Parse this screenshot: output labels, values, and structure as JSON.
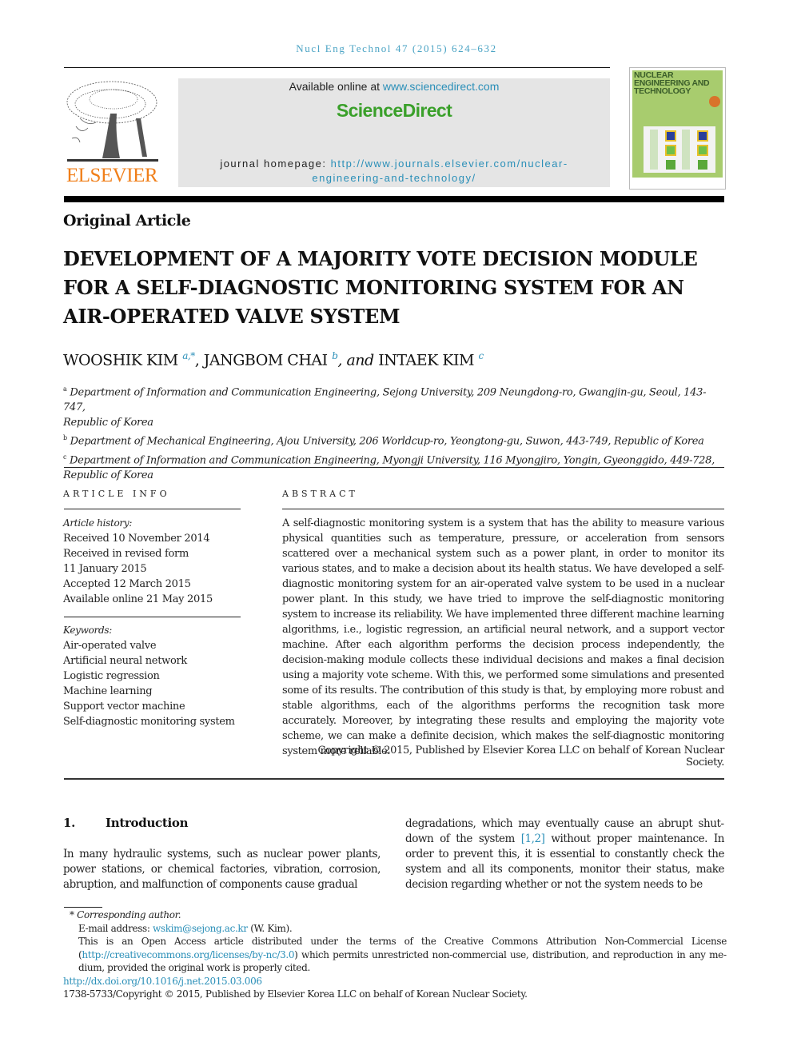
{
  "header": {
    "citation": "Nucl Eng Technol 47 (2015) 624–632",
    "publisher_logo_text": "ELSEVIER",
    "available_prefix": "Available online at ",
    "available_link": "www.sciencedirect.com",
    "sciencedirect_logo": "ScienceDirect",
    "homepage_prefix": "journal homepage: ",
    "homepage_link_line1": "http://www.journals.elsevier.com/nuclear-",
    "homepage_link_line2": "engineering-and-technology/",
    "cover_title_lines": [
      "NUCLEAR",
      "ENGINEERING AND",
      "TECHNOLOGY"
    ]
  },
  "article": {
    "type": "Original Article",
    "title_lines": [
      "DEVELOPMENT OF A MAJORITY VOTE DECISION MODULE",
      "FOR A SELF-DIAGNOSTIC MONITORING SYSTEM FOR AN",
      "AIR-OPERATED VALVE SYSTEM"
    ],
    "authors": [
      {
        "name": "WOOSHIK KIM",
        "sup": "a,*"
      },
      {
        "name": "JANGBOM CHAI",
        "sup": "b"
      },
      {
        "name": "INTAEK KIM",
        "sup": "c"
      }
    ],
    "author_sep": ", ",
    "author_and": ", and ",
    "affiliations": [
      {
        "sup": "a",
        "lines": [
          "Department of Information and Communication Engineering, Sejong University, 209 Neungdong-ro, Gwangjin-gu, Seoul, 143-747,",
          "Republic of Korea"
        ]
      },
      {
        "sup": "b",
        "lines": [
          "Department of Mechanical Engineering, Ajou University, 206 Worldcup-ro, Yeongtong-gu, Suwon, 443-749, Republic of Korea"
        ]
      },
      {
        "sup": "c",
        "lines": [
          "Department of Information and Communication Engineering, Myongji University, 116 Myongjiro, Yongin, Gyeonggido, 449-728,",
          "Republic of Korea"
        ]
      }
    ]
  },
  "article_info": {
    "heading": "ARTICLE INFO",
    "history_label": "Article history:",
    "history": [
      "Received 10 November 2014",
      "Received in revised form",
      "11 January 2015",
      "Accepted 12 March 2015",
      "Available online 21 May 2015"
    ],
    "keywords_label": "Keywords:",
    "keywords": [
      "Air-operated valve",
      "Artificial neural network",
      "Logistic regression",
      "Machine learning",
      "Support vector machine",
      "Self-diagnostic monitoring system"
    ]
  },
  "abstract": {
    "heading": "ABSTRACT",
    "text": "A self-diagnostic monitoring system is a system that has the ability to measure various physical quantities such as temperature, pressure, or acceleration from sensors scattered over a mechanical system such as a power plant, in order to monitor its various states, and to make a decision about its health status. We have developed a self-diagnostic monitoring system for an air-operated valve system to be used in a nuclear power plant. In this study, we have tried to improve the self-diagnostic monitoring system to increase its reliability. We have implemented three different machine learning algorithms, i.e., logistic regression, an artificial neural network, and a support vector machine. After each algorithm performs the decision process independently, the decision-making module collects these individual decisions and makes a final decision using a majority vote scheme. With this, we per­formed some simulations and presented some of its results. The contribution of this study is that, by employing more robust and stable algorithms, each of the algorithms performs the recognition task more accurately. Moreover, by integrating these results and employing the majority vote scheme, we can make a definite decision, which makes the self-diagnostic monitoring system more reliable.",
    "copyright": "Copyright © 2015, Published by Elsevier Korea LLC on behalf of Korean Nuclear Society."
  },
  "introduction": {
    "number": "1.",
    "heading": "Introduction",
    "col1": "In many hydraulic systems, such as nuclear power plants, power stations, or chemical factories, vibration, corrosion, abruption, and malfunction of components cause gradual",
    "col2_before_ref": "degradations, which may eventually cause an abrupt shut­down of the system ",
    "col2_ref": "[1,2]",
    "col2_after_ref": " without proper maintenance. In order to prevent this, it is essential to constantly check the system and all its components, monitor their status, make decision regarding whether or not the system needs to be"
  },
  "footnotes": {
    "corresponding": "* Corresponding author.",
    "email_label": "E-mail address: ",
    "email": "wskim@sejong.ac.kr",
    "email_suffix": " (W. Kim).",
    "license_prefix": "This is an Open Access article distributed under the terms of the Creative Commons Attribution Non-Commercial License (",
    "license_link": "http://creativecommons.org/licenses/by-nc/3.0",
    "license_suffix": ") which permits unrestricted non-commercial use, distribution, and reproduction in any me­dium, provided the original work is properly cited.",
    "doi": "http://dx.doi.org/10.1016/j.net.2015.03.006",
    "issn_copyright": "1738-5733/Copyright © 2015, Published by Elsevier Korea LLC on behalf of Korean Nuclear Society."
  },
  "colors": {
    "link": "#2a8fb8",
    "elsevier_orange": "#f07f1a",
    "sciencedirect_green": "#3aa02a",
    "header_box": "#e5e5e5",
    "cover_green": "#a8cc6e"
  }
}
